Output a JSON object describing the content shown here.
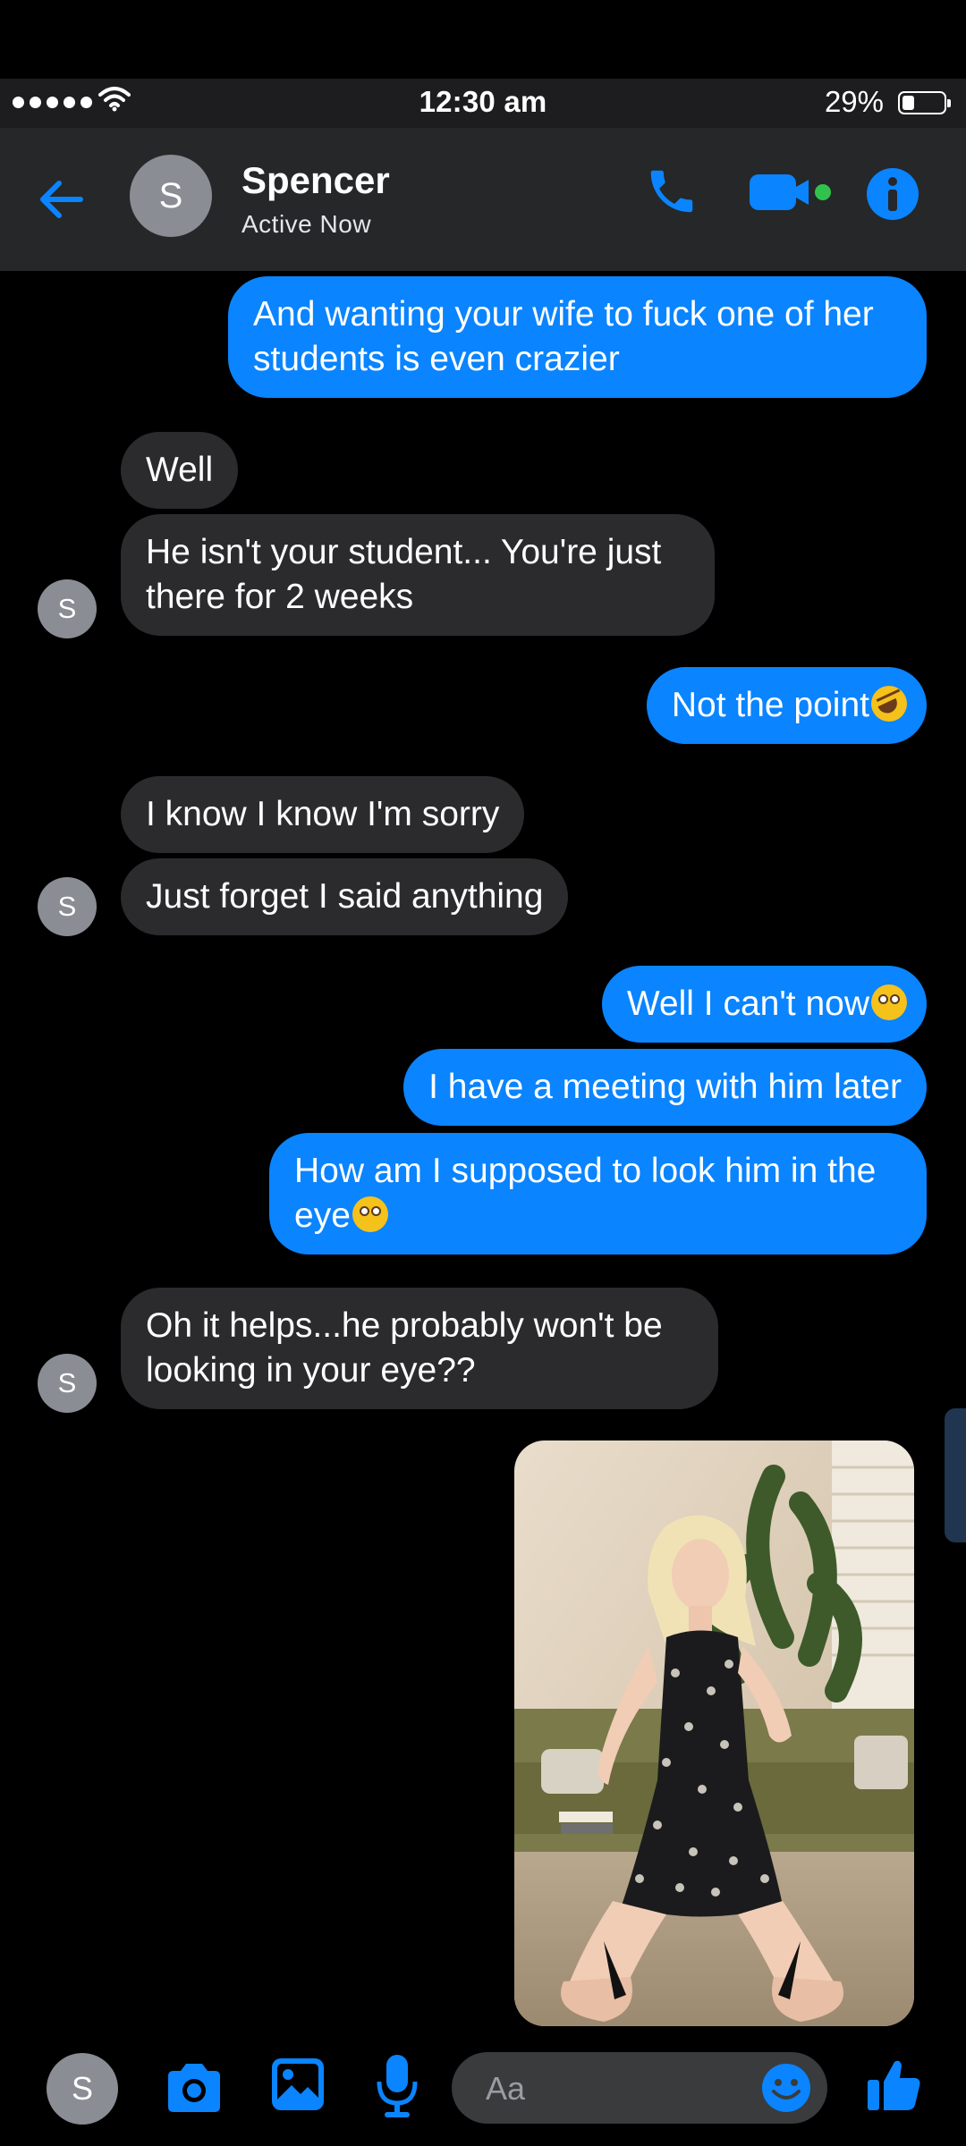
{
  "status_bar": {
    "time": "12:30 am",
    "battery_percent": "29%",
    "battery_level": 0.29
  },
  "header": {
    "avatar_initial": "S",
    "contact_name": "Spencer",
    "contact_status": "Active Now",
    "icons": [
      "back-arrow-icon",
      "phone-icon",
      "video-camera-icon",
      "info-icon"
    ]
  },
  "messages": [
    {
      "sender": "me",
      "text": "And wanting your wife to fuck one of her students is even crazier"
    },
    {
      "sender": "them",
      "text": "Well"
    },
    {
      "sender": "them",
      "text": "He isn't your student... You're just there for 2 weeks"
    },
    {
      "sender": "me",
      "text": "Not the point",
      "emoji": "rofl"
    },
    {
      "sender": "them",
      "text": "I know I know I'm sorry"
    },
    {
      "sender": "them",
      "text": "Just forget I said anything"
    },
    {
      "sender": "me",
      "text": "Well I can't now",
      "emoji": "flushed"
    },
    {
      "sender": "me",
      "text": "I have a meeting with him later"
    },
    {
      "sender": "me",
      "text": "How am I supposed to look him in the eye",
      "emoji": "flushed"
    },
    {
      "sender": "them",
      "text": "Oh it helps...he probably won't be looking in your eye??"
    },
    {
      "sender": "me",
      "type": "photo"
    }
  ],
  "them_avatar_initial": "S",
  "composer": {
    "avatar_initial": "S",
    "placeholder": "Aa",
    "icons": [
      "camera-icon",
      "gallery-icon",
      "microphone-icon",
      "emoji-icon",
      "thumbs-up-icon"
    ]
  },
  "colors": {
    "outgoing": "#0a84ff",
    "incoming": "#2b2b2e",
    "accent": "#0a84ff",
    "header": "#252729"
  }
}
